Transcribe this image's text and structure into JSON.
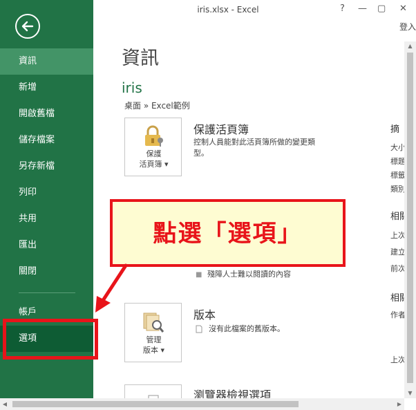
{
  "window": {
    "title": "iris.xlsx - Excel",
    "help": "?",
    "minimize": "—",
    "restore": "▢",
    "close": "✕",
    "signin": "登入"
  },
  "sidebar": {
    "items": [
      {
        "label": "資訊"
      },
      {
        "label": "新增"
      },
      {
        "label": "開啟舊檔"
      },
      {
        "label": "儲存檔案"
      },
      {
        "label": "另存新檔"
      },
      {
        "label": "列印"
      },
      {
        "label": "共用"
      },
      {
        "label": "匯出"
      },
      {
        "label": "關閉"
      },
      {
        "label": "帳戶"
      },
      {
        "label": "選項"
      }
    ]
  },
  "main": {
    "title": "資訊",
    "file_name": "iris",
    "breadcrumb": "桌面 » Excel範例",
    "protect": {
      "button_line1": "保護",
      "button_line2": "活頁簿 ▾",
      "title": "保護活頁簿",
      "desc_line1": "控制人員能對此活頁簿所做的變更類",
      "desc_line2": "型。"
    },
    "inspect": {
      "desc": "殘障人士難以閱讀的內容"
    },
    "versions": {
      "button_line1": "管理",
      "button_line2": "版本 ▾",
      "title": "版本",
      "desc": "沒有此檔案的舊版本。"
    },
    "browser": {
      "title": "瀏覽器檢視選項"
    }
  },
  "properties": {
    "head1": "摘",
    "row1": "大小",
    "row2": "標題",
    "row3": "標籤",
    "row4": "類別",
    "head2": "相關",
    "row5": "上次",
    "row6": "建立",
    "row7": "前次",
    "head3": "相關",
    "row8": "作者",
    "row9": "上次"
  },
  "annotation": {
    "callout": "點選「選項」"
  },
  "colors": {
    "excel_green": "#217346",
    "annotation_red": "#e8141a",
    "callout_fill": "#fefcd2"
  }
}
